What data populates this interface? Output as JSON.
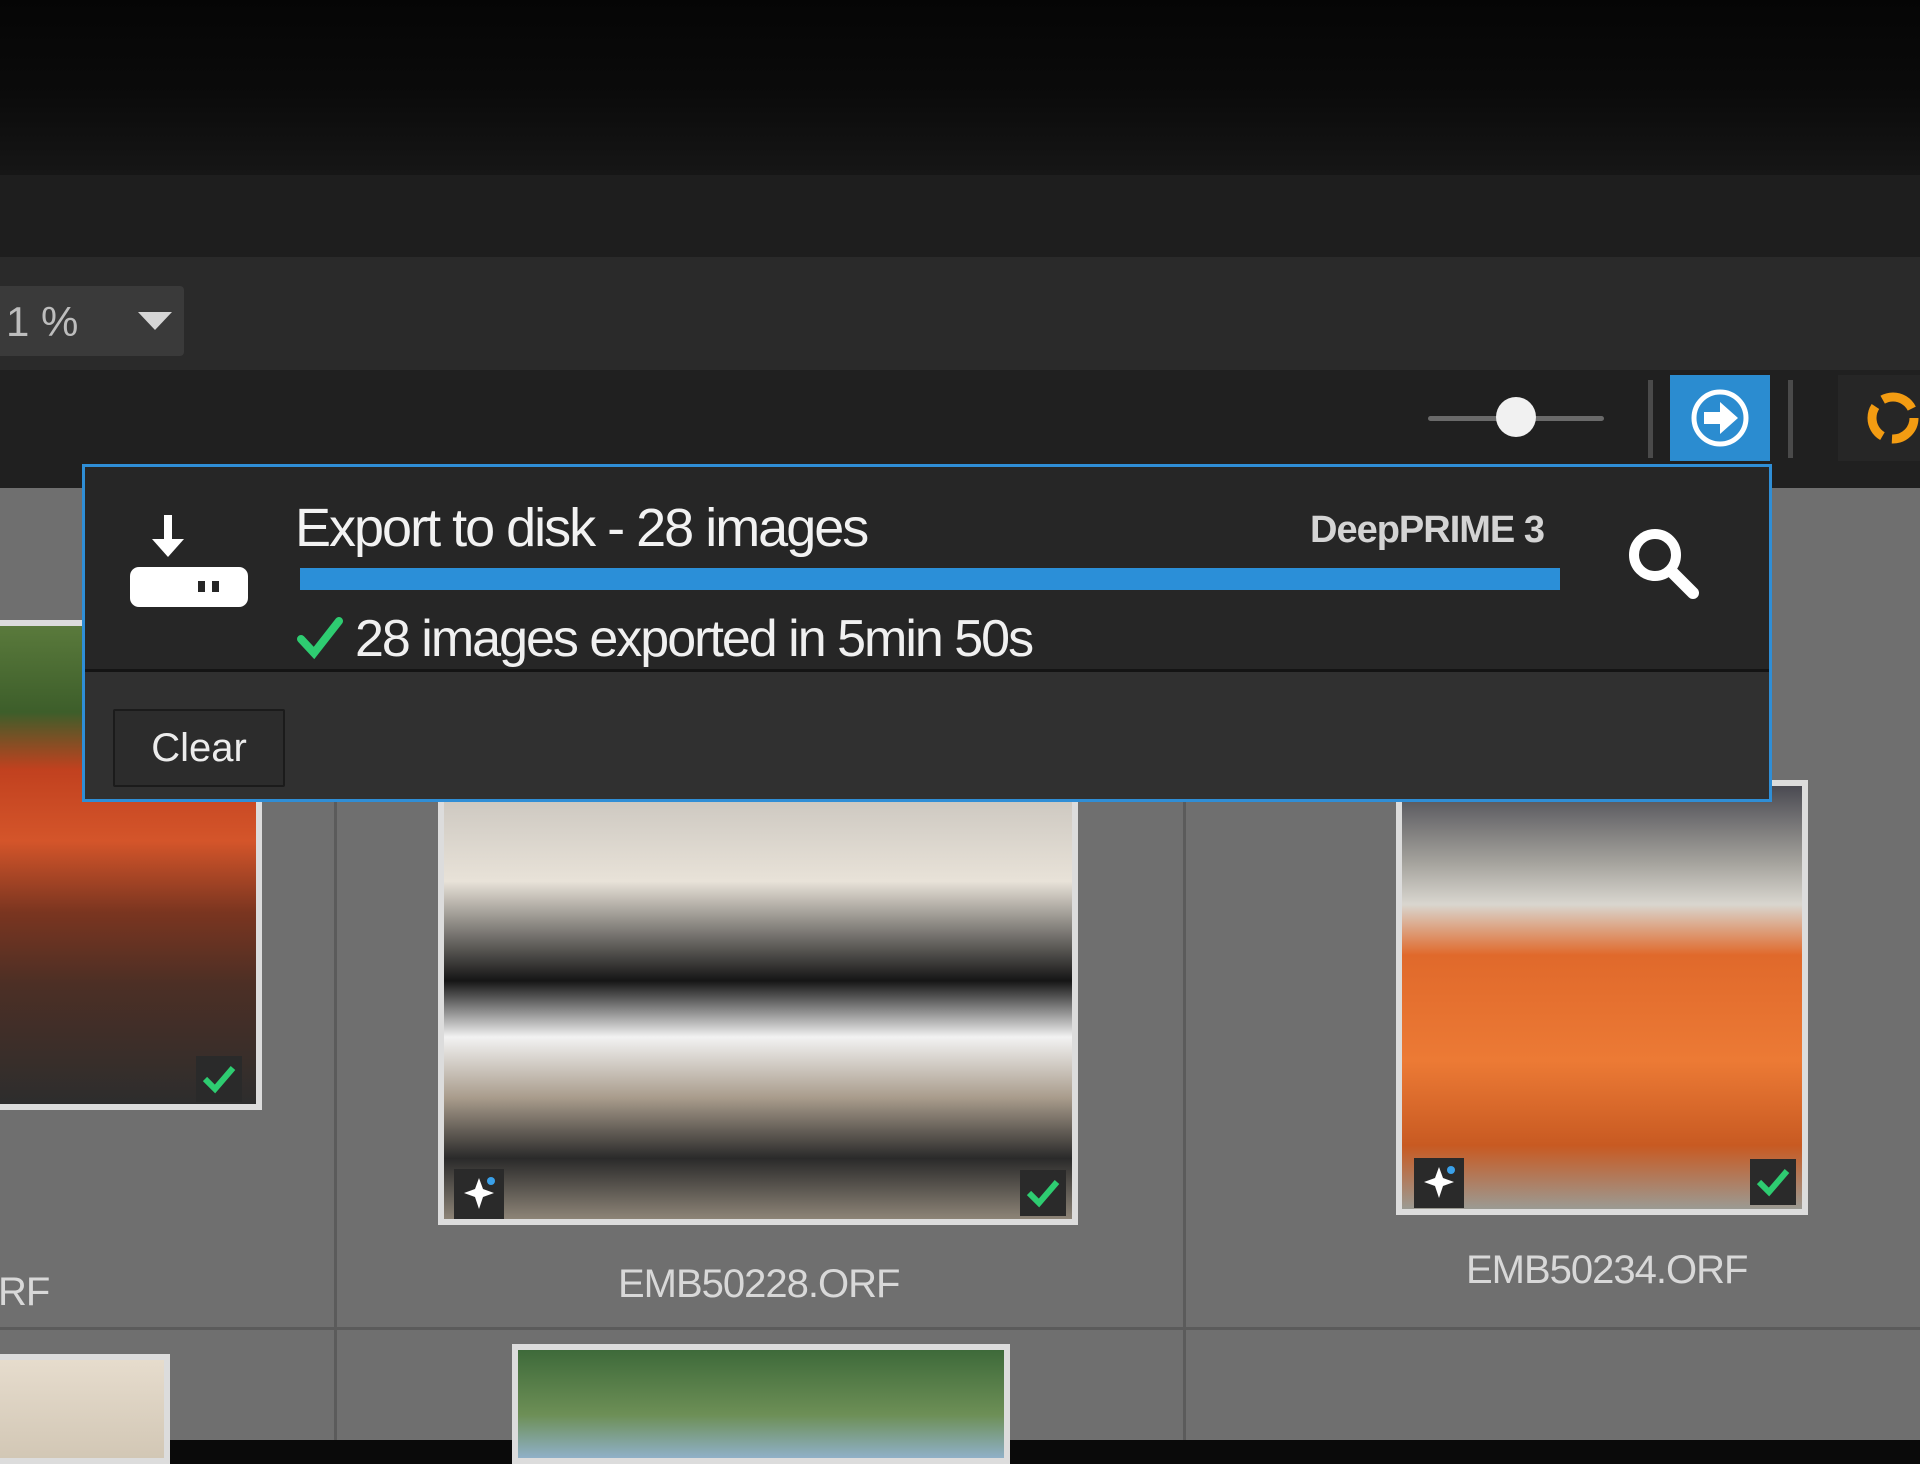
{
  "toolbar": {
    "zoom_value": "1 %",
    "thumbnail_size_level": 0.5
  },
  "colors": {
    "accent": "#2b8fd8",
    "success": "#2ecc71",
    "panel_bg": "#262626",
    "grid_bg": "#6f6f6f"
  },
  "export_panel": {
    "icon": "export-to-disk-icon",
    "title": "Export to disk - 28 images",
    "engine": "DeepPRIME 3",
    "progress": 1.0,
    "result": "28 images exported in 5min 50s",
    "clear_label": "Clear",
    "search_icon": "magnifier-icon"
  },
  "thumbnails": [
    {
      "filename": "RF",
      "edited": false,
      "exported": true
    },
    {
      "filename": "EMB50228.ORF",
      "edited": true,
      "exported": true
    },
    {
      "filename": "EMB50234.ORF",
      "edited": true,
      "exported": true
    }
  ]
}
